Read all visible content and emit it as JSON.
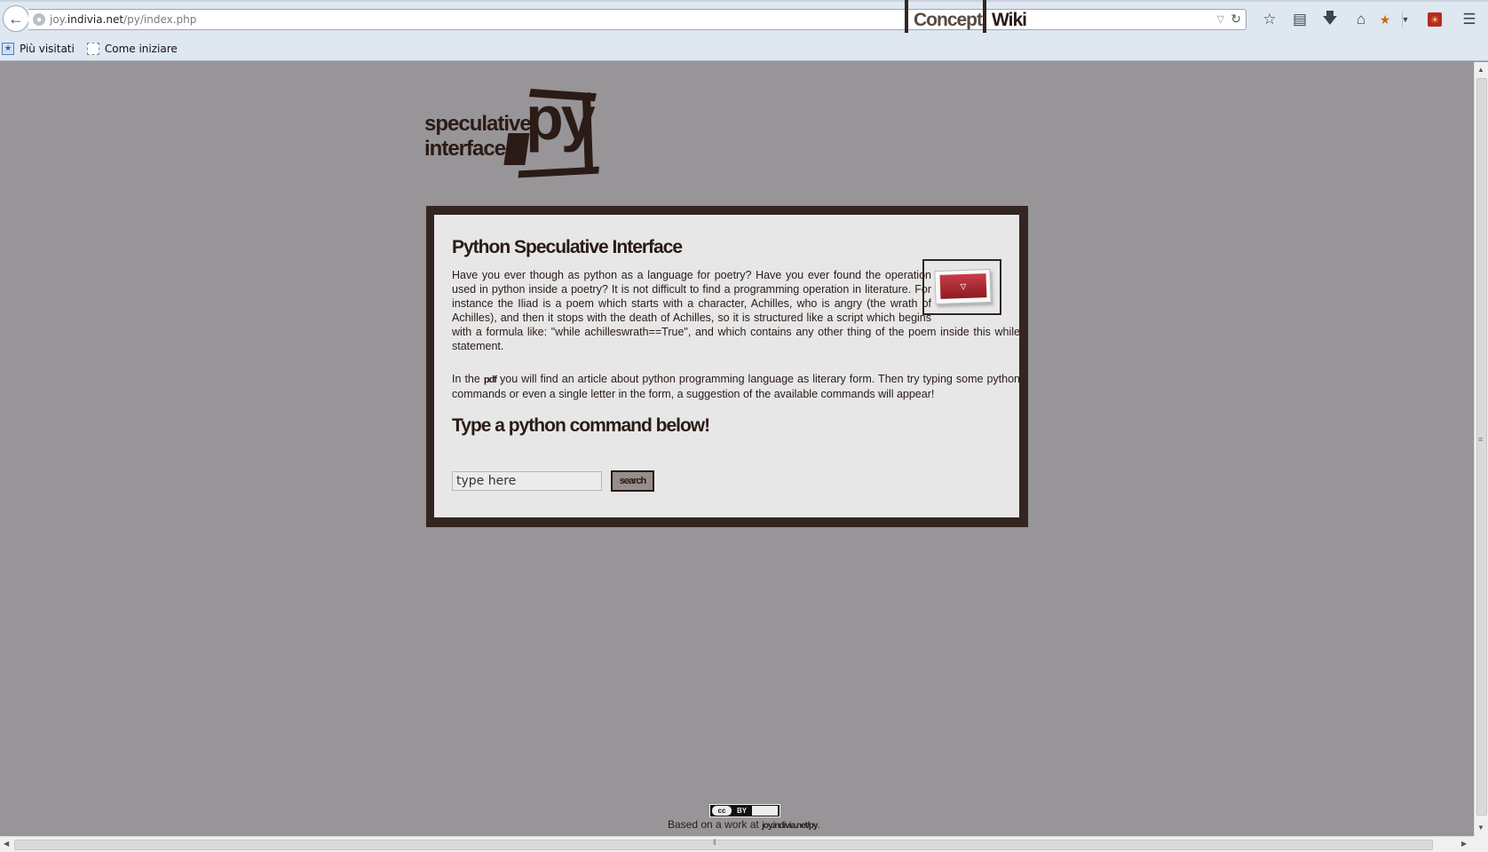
{
  "browser": {
    "url_prefix": "joy.",
    "url_host": "indivia.net",
    "url_path": "/py/index.php",
    "bookmarks": [
      {
        "label": "Più visitati"
      },
      {
        "label": "Come iniziare"
      }
    ],
    "icons": [
      "back-arrow-icon",
      "site-identity-icon",
      "url-dropdown-icon",
      "reload-icon",
      "bookmark-star-icon",
      "reading-list-icon",
      "download-icon",
      "home-icon",
      "addon-icon",
      "menu-icon"
    ]
  },
  "logo": {
    "line1": "speculative",
    "line2": "interface",
    "mark": "py"
  },
  "nav": {
    "concept": "Concept",
    "wiki": "Wiki"
  },
  "main": {
    "title": "Python Speculative Interface",
    "paragraph1": "Have you ever though as python as a language for poetry? Have you ever found the operation used in python inside a poetry? It is not difficult to find a programming operation in literature. For instance the Iliad is a poem which starts with a character, Achilles, who is angry (the wrath of Achilles), and then it stops with the death of Achilles, so it is structured like a script which begins with a formula like: \"while achilleswrath==True\", and which contains any other thing of the poem inside this while statement.",
    "paragraph2_before": "In the ",
    "pdf_link": "pdf",
    "paragraph2_after": " you will find an article about python programming language as literary form. Then try typing some python commands or even a single letter in the form, a suggestion of the available commands will appear!",
    "subtitle": "Type a python command below!",
    "input_value": "type here",
    "search_label": "search"
  },
  "footer": {
    "cc_label": "cc",
    "by_label": "BY",
    "text": "Based on a work at ",
    "link": "joy.indivia.net/py",
    "end": "."
  },
  "colors": {
    "page_bg": "#989598",
    "frame": "#342520",
    "panel": "#e7e7e7",
    "text": "#2a1b16"
  }
}
